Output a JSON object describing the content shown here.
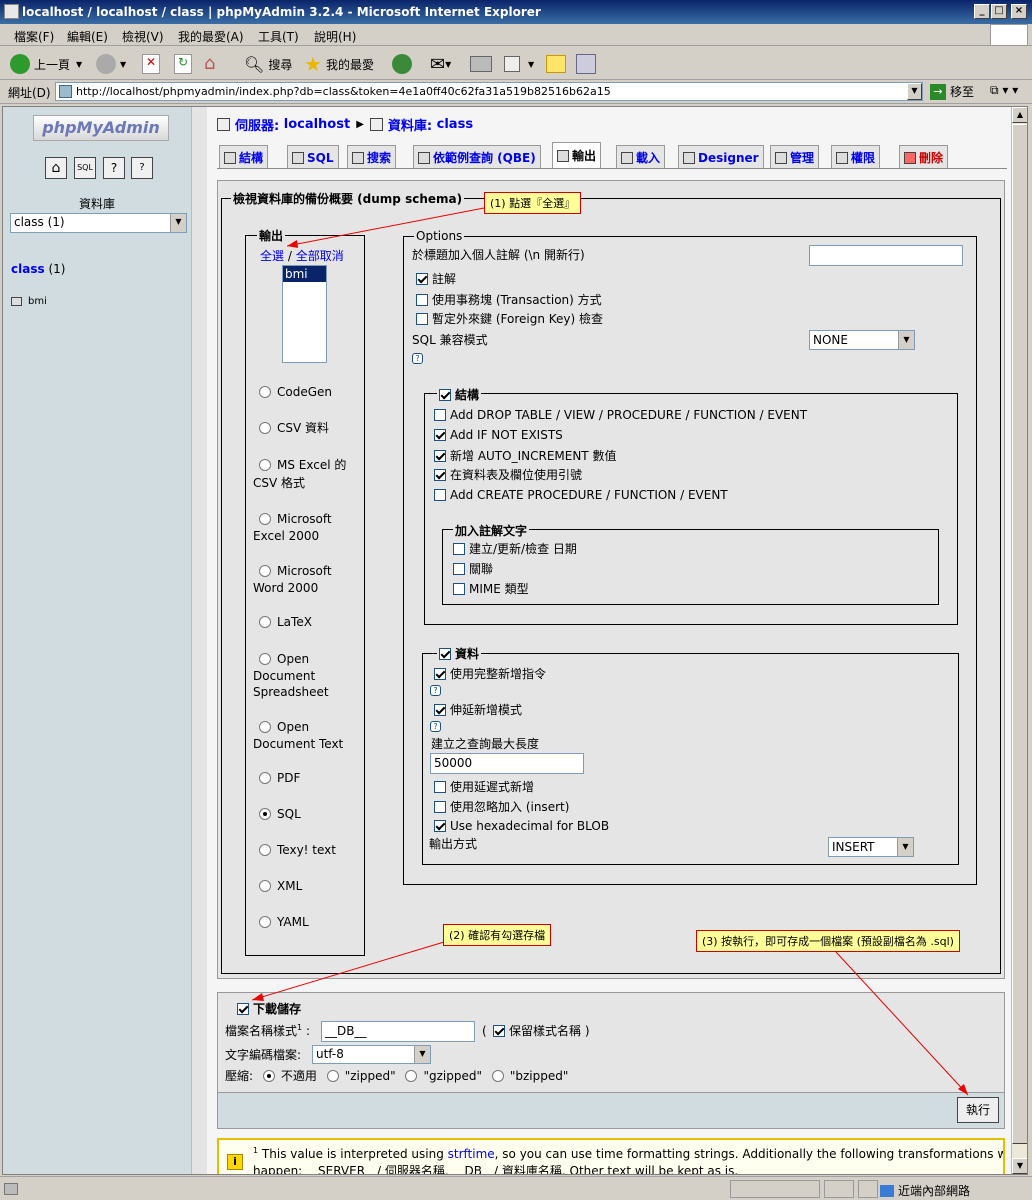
{
  "window": {
    "title": "localhost / localhost / class | phpMyAdmin 3.2.4 - Microsoft Internet Explorer"
  },
  "menu": [
    "檔案(F)",
    "編輯(E)",
    "檢視(V)",
    "我的最愛(A)",
    "工具(T)",
    "說明(H)"
  ],
  "toolbar": {
    "back": "上一頁",
    "search": "搜尋",
    "favorites": "我的最愛"
  },
  "address": {
    "label": "網址(D)",
    "url": "http://localhost/phpmyadmin/index.php?db=class&token=4e1a0ff40c62fa31a519b82516b62a15",
    "go": "移至"
  },
  "left": {
    "logo": "phpMyAdmin",
    "db_label": "資料庫",
    "db_select": "class (1)",
    "db_name": "class",
    "db_count": "(1)",
    "table": "bmi"
  },
  "breadcrumb": {
    "server_label": "伺服器:",
    "server": "localhost",
    "db_label": "資料庫:",
    "db": "class"
  },
  "tabs": [
    "結構",
    "SQL",
    "搜索",
    "依範例查詢 (QBE)",
    "輸出",
    "載入",
    "Designer",
    "管理",
    "權限",
    "刪除"
  ],
  "export": {
    "legend": "檢視資料庫的備份概要 (dump schema)",
    "output_legend": "輸出",
    "select_all": "全選",
    "sep": "/",
    "deselect_all": "全部取消",
    "tables": [
      "bmi"
    ],
    "formats": [
      "CodeGen",
      "CSV 資料",
      "MS Excel 的",
      "CSV 格式",
      "Microsoft",
      "Excel 2000",
      "Microsoft",
      "Word 2000",
      "LaTeX",
      "Open",
      "Document",
      "Spreadsheet",
      "Open",
      "Document Text",
      "PDF",
      "SQL",
      "Texy! text",
      "XML",
      "YAML"
    ],
    "options_legend": "Options",
    "header_comment_label": "於標題加入個人註解 (\\n 開新行)",
    "opt_comments": "註解",
    "opt_transaction": "使用事務塊 (Transaction) 方式",
    "opt_fk": "暫定外來鍵 (Foreign Key) 檢查",
    "sql_compat_label": "SQL 兼容模式",
    "sql_compat": "NONE",
    "structure_legend": "結構",
    "structure_opts": [
      "Add DROP TABLE / VIEW / PROCEDURE / FUNCTION / EVENT",
      "Add IF NOT EXISTS",
      "新增 AUTO_INCREMENT 數值",
      "在資料表及欄位使用引號",
      "Add CREATE PROCEDURE / FUNCTION / EVENT"
    ],
    "comments_legend": "加入註解文字",
    "comments_opts": [
      "建立/更新/檢查 日期",
      "關聯",
      "MIME 類型"
    ],
    "data_legend": "資料",
    "data_complete": "使用完整新增指令",
    "data_extended": "伸延新增模式",
    "max_query_label": "建立之查詢最大長度",
    "max_query": "50000",
    "data_delayed": "使用延遲式新增",
    "data_ignore": "使用忽略加入 (insert)",
    "data_hex": "Use hexadecimal for BLOB",
    "export_type_label": "輸出方式",
    "export_type": "INSERT"
  },
  "save": {
    "legend": "下載儲存",
    "filename_label": "檔案名稱樣式",
    "sup": "1",
    "colon": ":",
    "filename": "__DB__",
    "paren_open": "(",
    "remember": "保留樣式名稱",
    "paren_close": ")",
    "charset_label": "文字編碼檔案:",
    "charset": "utf-8",
    "compress_label": "壓縮:",
    "compress": [
      "不適用",
      "\"zipped\"",
      "\"gzipped\"",
      "\"bzipped\""
    ],
    "go": "執行"
  },
  "note": {
    "sup": "1",
    "pre": "This value is interpreted using ",
    "link": "strftime",
    "post": ", so you can use time formatting strings. Additionally the following transformations will",
    "line2": "happen: __SERVER__/ 伺服器名稱, __DB__/ 資料庫名稱. Other text will be kept as is."
  },
  "callouts": [
    "(1) 點選『全選』",
    "(2) 確認有勾選存檔",
    "(3) 按執行，即可存成一個檔案 (預設副檔名為 .sql)"
  ],
  "status": {
    "zone": "近端內部網路"
  }
}
